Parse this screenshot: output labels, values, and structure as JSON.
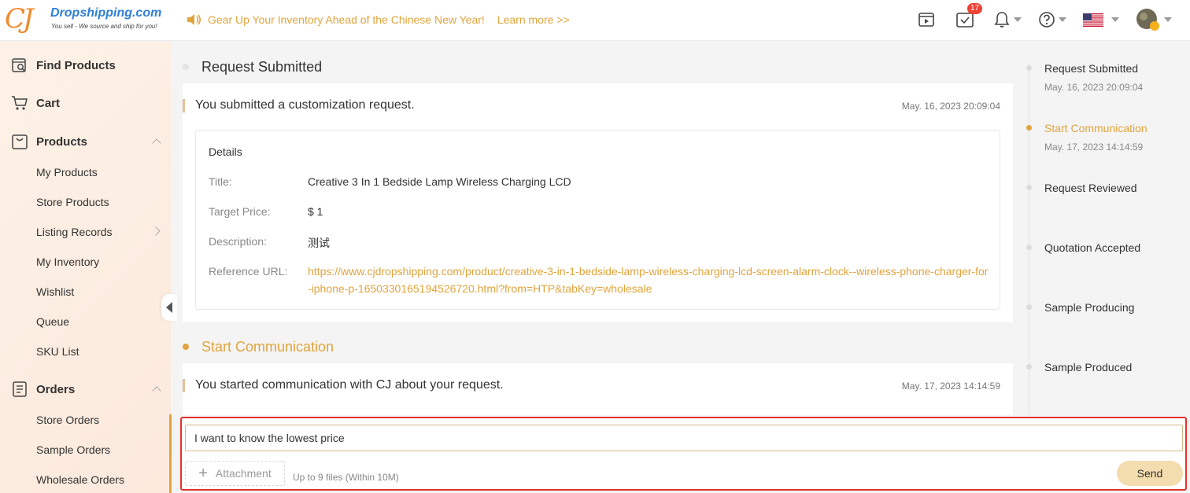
{
  "header": {
    "logo_brand": "Dropshipping.com",
    "logo_tagline": "You sell - We source and ship for you!",
    "announcement": "Gear Up Your Inventory Ahead of the Chinese New Year!",
    "learn_more": "Learn more >>",
    "tasks_badge": "17",
    "icons": [
      "video-icon",
      "tasks-icon",
      "bell-icon",
      "help-icon",
      "us-flag-icon",
      "avatar"
    ]
  },
  "sidebar": {
    "find_products": "Find Products",
    "cart": "Cart",
    "products": "Products",
    "products_items": [
      "My Products",
      "Store Products",
      "Listing Records",
      "My Inventory",
      "Wishlist",
      "Queue",
      "SKU List"
    ],
    "orders": "Orders",
    "orders_items": [
      "Store Orders",
      "Sample Orders",
      "Wholesale Orders"
    ]
  },
  "main": {
    "section1": {
      "title": "Request Submitted",
      "card_text": "You submitted a customization request.",
      "card_time": "May. 16, 2023 20:09:04",
      "details_head": "Details",
      "title_label": "Title:",
      "title_value": "Creative 3 In 1 Bedside Lamp Wireless Charging LCD",
      "price_label": "Target Price:",
      "price_value": "$ 1",
      "desc_label": "Description:",
      "desc_value": "测试",
      "url_label": "Reference URL:",
      "url_value": "https://www.cjdropshipping.com/product/creative-3-in-1-bedside-lamp-wireless-charging-lcd-screen-alarm-clock--wireless-phone-charger-for-iphone-p-1650330165194526720.html?from=HTP&tabKey=wholesale"
    },
    "section2": {
      "title": "Start Communication",
      "card_text": "You started communication with CJ about your request.",
      "card_time": "May. 17, 2023 14:14:59"
    }
  },
  "timeline": {
    "steps": [
      {
        "label": "Request Submitted",
        "time": "May. 16, 2023 20:09:04"
      },
      {
        "label": "Start Communication",
        "time": "May. 17, 2023 14:14:59"
      },
      {
        "label": "Request Reviewed",
        "time": ""
      },
      {
        "label": "Quotation Accepted",
        "time": ""
      },
      {
        "label": "Sample Producing",
        "time": ""
      },
      {
        "label": "Sample Produced",
        "time": ""
      }
    ],
    "active_step": 1
  },
  "composer": {
    "message_value": "I want to know the lowest price",
    "attachment_label": "Attachment",
    "hint": "Up to 9 files (Within 10M)",
    "send_label": "Send"
  },
  "colors": {
    "accent": "#e0a43c",
    "highlight_border": "#e5322d",
    "badge": "#f04134",
    "send_bg": "#f3dcae"
  }
}
